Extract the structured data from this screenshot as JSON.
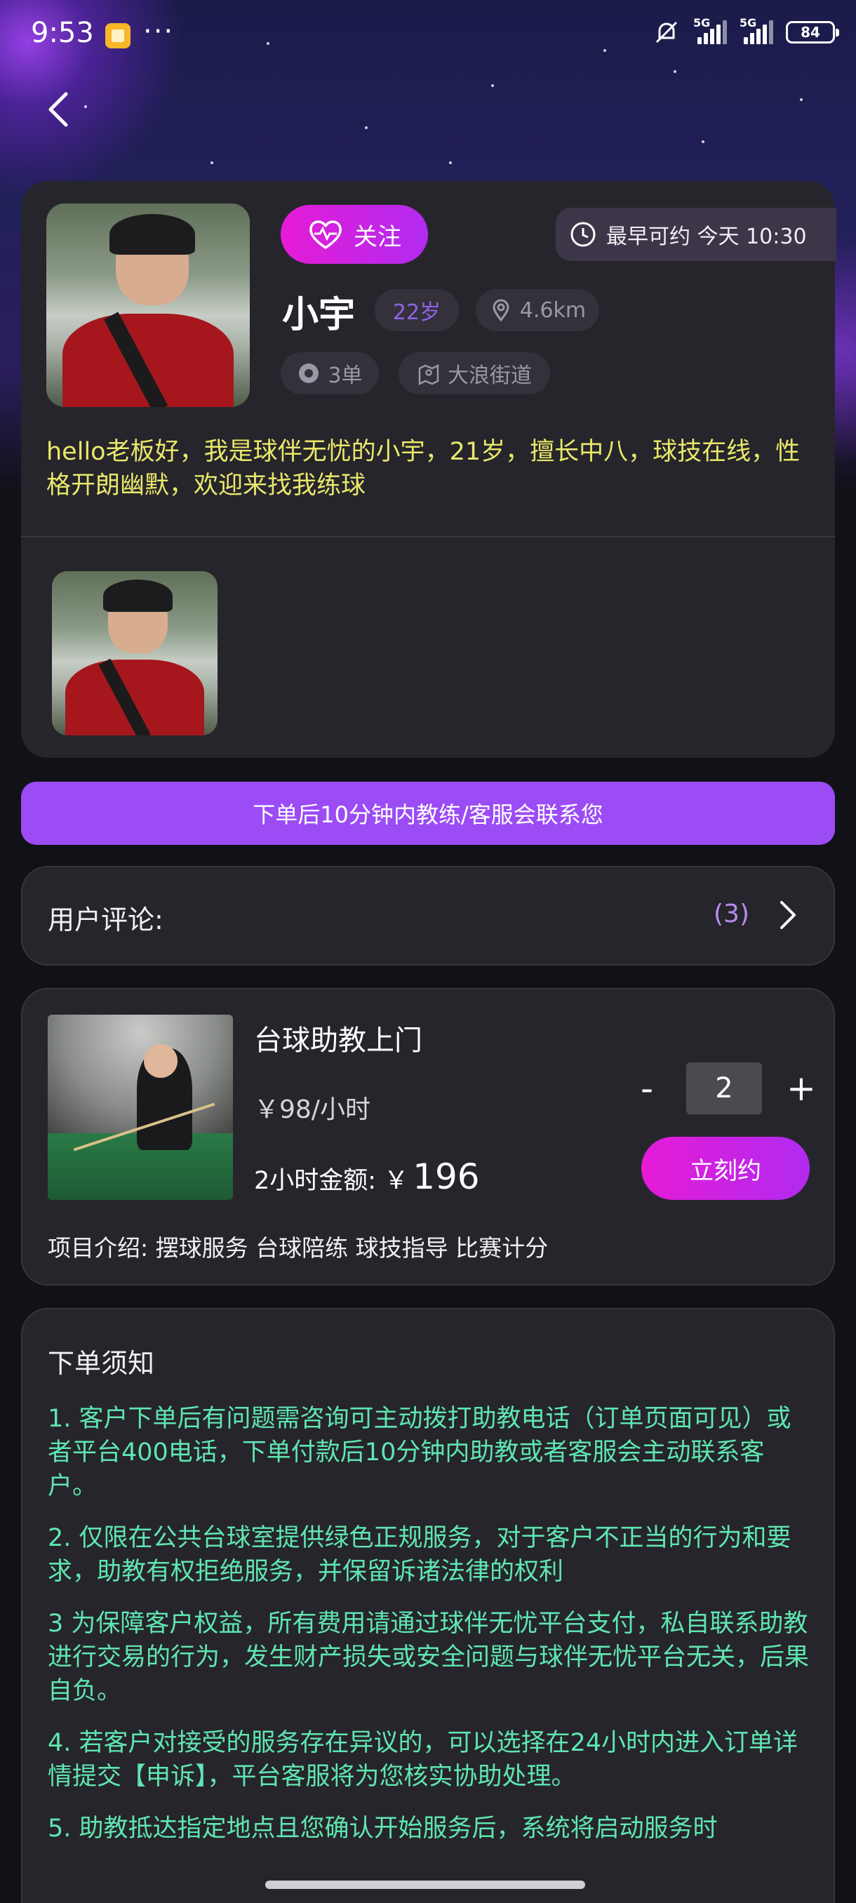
{
  "status_bar": {
    "time": "9:53",
    "dots": "···",
    "signal1": "5G",
    "signal2": "5G",
    "battery": "84"
  },
  "profile": {
    "follow_label": "关注",
    "earliest_label": "最早可约 今天 10:30",
    "name": "小宇",
    "age": "22岁",
    "distance": "4.6km",
    "orders": "3单",
    "street": "大浪街道",
    "intro": "hello老板好，我是球伴无忧的小宇，21岁，擅长中八，球技在线，性格开朗幽默，欢迎来找我练球"
  },
  "notice": "下单后10分钟内教练/客服会联系您",
  "reviews": {
    "label": "用户评论:",
    "count": "(3)"
  },
  "service": {
    "title": "台球助教上门",
    "price": "￥98/小时",
    "total_label": "2小时金额: ￥",
    "total_value": "196",
    "quantity": "2",
    "minus": "-",
    "plus": "+",
    "book_label": "立刻约",
    "description": "项目介绍: 摆球服务 台球陪练 球技指导 比赛计分"
  },
  "rules": {
    "title": "下单须知",
    "items": [
      "1. 客户下单后有问题需咨询可主动拨打助教电话（订单页面可见）或者平台400电话，下单付款后10分钟内助教或者客服会主动联系客户。",
      "2. 仅限在公共台球室提供绿色正规服务，对于客户不正当的行为和要求，助教有权拒绝服务，并保留诉诸法律的权利",
      "3 为保障客户权益，所有费用请通过球伴无忧平台支付，私自联系助教进行交易的行为，发生财产损失或安全问题与球伴无忧平台无关，后果自负。",
      "4. 若客户对接受的服务存在异议的，可以选择在24小时内进入订单详情提交【申诉】，平台客服将为您核实协助处理。",
      "5. 助教抵达指定地点且您确认开始服务后，系统将启动服务时"
    ]
  },
  "colors": {
    "accent_gradient_start": "#e51bd6",
    "accent_gradient_end": "#b12bf0",
    "notice_bg": "#9b4cf5",
    "intro_text": "#e9e86b",
    "rules_text": "#5fe6b1",
    "card_bg": "#26252b"
  },
  "icons": {
    "back": "chevron-left-icon",
    "follow": "heart-pulse-icon",
    "earliest": "clock-icon",
    "distance": "location-pin-icon",
    "orders": "billiard-ball-icon",
    "street": "map-pin-icon",
    "reviews_arrow": "chevron-right-icon"
  }
}
